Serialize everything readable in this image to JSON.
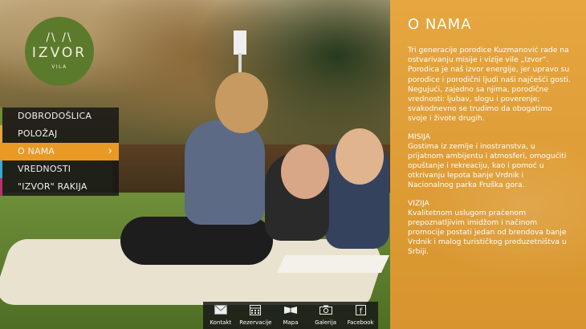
{
  "logo": {
    "mark": "/\\ /\\",
    "name": "IZVOR",
    "sub": "VILA"
  },
  "menu": {
    "items": [
      {
        "label": "DOBRODOŠLICA",
        "color": "#6e8d2f"
      },
      {
        "label": "POLOŽAJ",
        "color": "#e6a33a"
      },
      {
        "label": "O NAMA",
        "color": "#e99a25"
      },
      {
        "label": "VREDNOSTI",
        "color": "#3aa7d2"
      },
      {
        "label": "\"IZVOR\" RAKIJA",
        "color": "#b8326e"
      }
    ],
    "active_index": 2,
    "active_chevron": "›"
  },
  "panel": {
    "title": "O NAMA",
    "intro": "Tri generacije porodice Kuzmanović rade na ostvarivanju misije i vizije vile „Izvor“. Porodica je naš izvor energije, jer upravo su porodice i porodični ljudi naši najčešći gosti. Negujući, zajedno sa njima, porodične vrednosti: ljubav, slogu i poverenje; svakodnevno se trudimo da obogatimo svoje i živote drugih.",
    "mission_heading": "MISIJA",
    "mission_text": "Gostima iz zemlje i inostranstva, u prijatnom ambijentu i atmosferi, omogućiti opuštanje i rekreaciju, kao i pomoć u otkrivanju lepota banje Vrdnik i Nacionalnog parka Fruška gora.",
    "vision_heading": "VIZIJA",
    "vision_text": "Kvalitetnom uslugom praćenom prepoznatljivim imidžom i načinom promocije postati jedan od brendova banje Vrdnik i malog turističkog preduzetništva u Srbiji."
  },
  "toolbar": {
    "items": [
      {
        "label": "Kontakt",
        "icon": "mail-icon"
      },
      {
        "label": "Rezervacije",
        "icon": "calendar-icon"
      },
      {
        "label": "Mapa",
        "icon": "map-icon"
      },
      {
        "label": "Galerija",
        "icon": "camera-icon"
      },
      {
        "label": "Facebook",
        "icon": "facebook-icon"
      }
    ]
  }
}
